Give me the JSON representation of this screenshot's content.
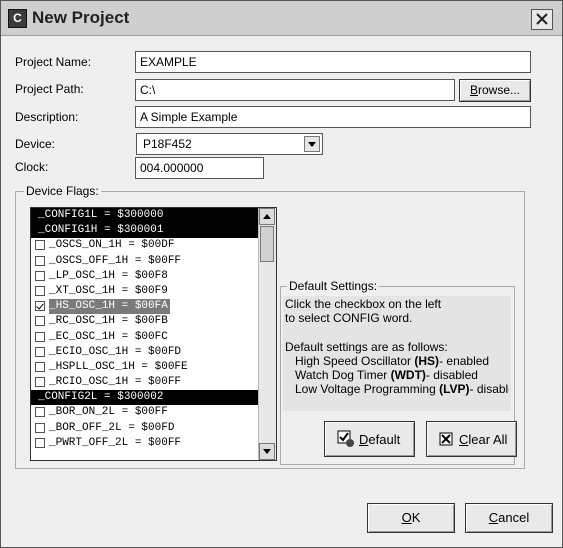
{
  "window": {
    "title": "New Project",
    "close_label": "×"
  },
  "form": {
    "project_name": {
      "label": "Project Name:",
      "value": "EXAMPLE"
    },
    "project_path": {
      "label": "Project Path:",
      "value": "C:\\"
    },
    "browse_button": {
      "label_underlined": "B",
      "label_rest": "rowse..."
    },
    "description": {
      "label": "Description:",
      "value": "A Simple Example"
    },
    "device": {
      "label": "Device:",
      "value": "P18F452"
    },
    "clock": {
      "label": "Clock:",
      "value": "004.000000"
    }
  },
  "device_flags": {
    "group_label": "Device Flags:",
    "items": [
      {
        "text": "_CONFIG1L = $300000",
        "header": true
      },
      {
        "text": "_CONFIG1H = $300001",
        "header": true
      },
      {
        "text": "_OSCS_ON_1H = $00DF",
        "checked": false
      },
      {
        "text": "_OSCS_OFF_1H = $00FF",
        "checked": false
      },
      {
        "text": "_LP_OSC_1H = $00F8",
        "checked": false
      },
      {
        "text": "_XT_OSC_1H = $00F9",
        "checked": false
      },
      {
        "text": "_HS_OSC_1H = $00FA",
        "checked": true,
        "selected": true
      },
      {
        "text": "_RC_OSC_1H = $00FB",
        "checked": false
      },
      {
        "text": "_EC_OSC_1H = $00FC",
        "checked": false
      },
      {
        "text": "_ECIO_OSC_1H = $00FD",
        "checked": false
      },
      {
        "text": "_HSPLL_OSC_1H = $00FE",
        "checked": false
      },
      {
        "text": "_RCIO_OSC_1H = $00FF",
        "checked": false
      },
      {
        "text": "_CONFIG2L = $300002",
        "header": true
      },
      {
        "text": "_BOR_ON_2L = $00FF",
        "checked": false
      },
      {
        "text": "_BOR_OFF_2L = $00FD",
        "checked": false
      },
      {
        "text": "_PWRT_OFF_2L = $00FF",
        "checked": false
      }
    ]
  },
  "default_settings": {
    "group_label": "Default Settings:",
    "line1": "Click the checkbox on the left",
    "line2": "to select CONFIG word.",
    "line3": "Default settings are as follows:",
    "hs": {
      "pre": "High Speed Oscillator ",
      "abbr": "(HS)",
      "post": "- enabled"
    },
    "wdt": {
      "pre": "Watch Dog Timer ",
      "abbr": "(WDT)",
      "post": "- disabled"
    },
    "lvp": {
      "pre": "Low Voltage Programming ",
      "abbr": "(LVP)",
      "post": "- disable"
    }
  },
  "buttons": {
    "default": {
      "underlined": "D",
      "rest": "efault"
    },
    "clear_all": {
      "underlined": "C",
      "rest": "lear All"
    },
    "ok": {
      "underlined": "O",
      "rest": "K"
    },
    "cancel": {
      "underlined": "C",
      "rest": "ancel"
    }
  }
}
